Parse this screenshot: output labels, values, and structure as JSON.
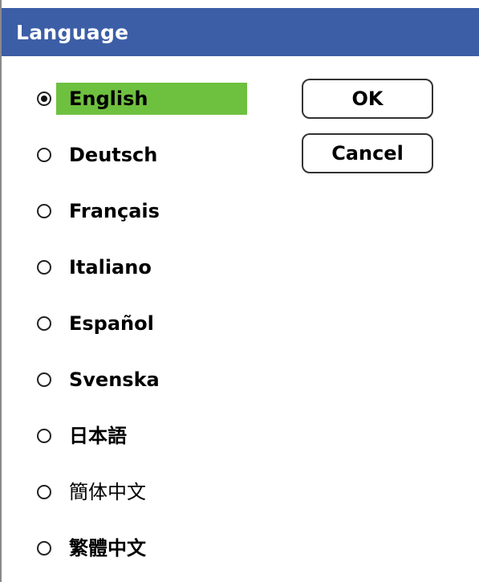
{
  "window": {
    "title": "Language"
  },
  "languages": [
    {
      "label": "English",
      "selected": true
    },
    {
      "label": "Deutsch",
      "selected": false
    },
    {
      "label": "Français",
      "selected": false
    },
    {
      "label": "Italiano",
      "selected": false
    },
    {
      "label": "Español",
      "selected": false
    },
    {
      "label": "Svenska",
      "selected": false
    },
    {
      "label": "日本語",
      "selected": false
    },
    {
      "label": "簡体中文",
      "selected": false
    },
    {
      "label": "繁體中文",
      "selected": false
    }
  ],
  "buttons": {
    "ok_label": "OK",
    "cancel_label": "Cancel"
  },
  "colors": {
    "titlebar": "#3c5ea6",
    "selection_highlight": "#6ec03f"
  }
}
